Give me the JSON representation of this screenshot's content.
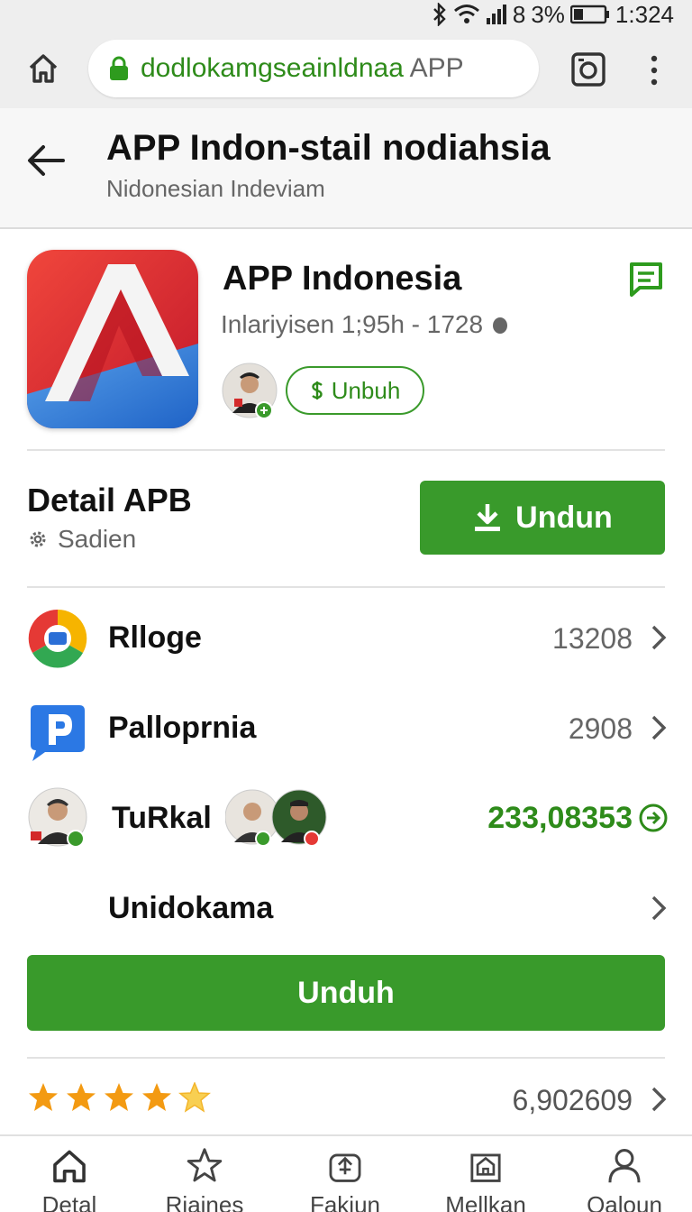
{
  "status_bar": {
    "battery": "3%",
    "time": "1:324",
    "signal_label": "8"
  },
  "browser": {
    "url_main": "dodlokamgseainldnaa",
    "url_suffix": "APP"
  },
  "header": {
    "title": "APP Indon-stail nodiahsia",
    "subtitle": "Nidonesian Indeviam"
  },
  "app": {
    "name": "APP Indonesia",
    "meta": "Inlariyisen 1;95h - 1728",
    "chip_label": "Unbuh",
    "accent_color": "#399a2b"
  },
  "detail": {
    "title": "Detail APB",
    "subtitle": "Sadien",
    "button_label": "Undun"
  },
  "rows": [
    {
      "label": "Rlloge",
      "value": "13208",
      "icon": "chrome-icon"
    },
    {
      "label": "Palloprnia",
      "value": "2908",
      "icon": "p-app-icon"
    },
    {
      "label": "TuRkal",
      "value": "233,08353",
      "icon": "user-avatar"
    },
    {
      "label": "Unidokama",
      "value": ""
    }
  ],
  "download_button": "Unduh",
  "rating": {
    "stars": 4.5,
    "count": "6,902609"
  },
  "nav": [
    {
      "label": "Detal",
      "icon": "home-icon"
    },
    {
      "label": "Riaines",
      "icon": "star-icon"
    },
    {
      "label": "Fakiun",
      "icon": "lock-icon"
    },
    {
      "label": "Mellkan",
      "icon": "store-icon"
    },
    {
      "label": "Qaloun",
      "icon": "person-icon"
    }
  ]
}
